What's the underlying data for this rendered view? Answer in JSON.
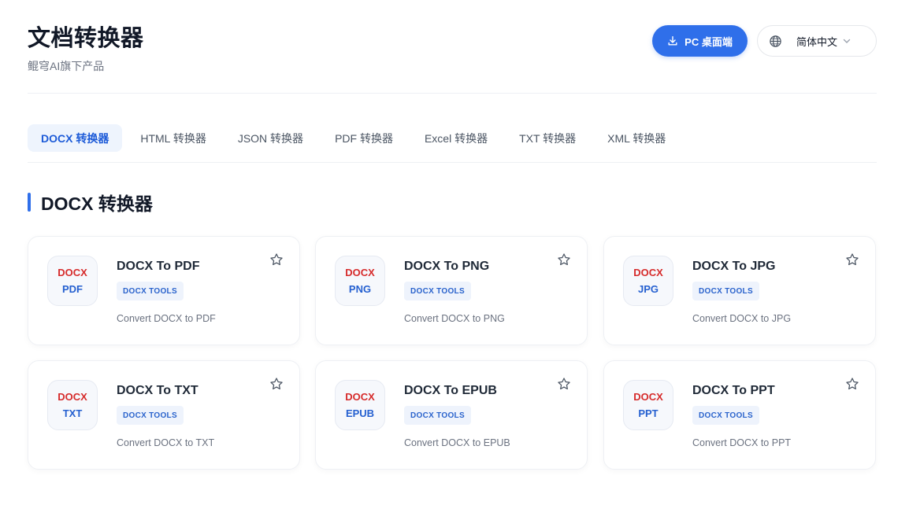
{
  "header": {
    "title": "文档转换器",
    "subtitle": "鲲穹AI旗下产品",
    "pc_button": "PC 桌面端",
    "language": "简体中文"
  },
  "tabs": [
    {
      "label": "DOCX 转换器",
      "active": true
    },
    {
      "label": "HTML 转换器",
      "active": false
    },
    {
      "label": "JSON 转换器",
      "active": false
    },
    {
      "label": "PDF 转换器",
      "active": false
    },
    {
      "label": "Excel 转换器",
      "active": false
    },
    {
      "label": "TXT 转换器",
      "active": false
    },
    {
      "label": "XML 转换器",
      "active": false
    }
  ],
  "section": {
    "title": "DOCX 转换器"
  },
  "cards": [
    {
      "from": "DOCX",
      "to": "PDF",
      "name": "DOCX To PDF",
      "tag": "DOCX TOOLS",
      "desc": "Convert DOCX to PDF"
    },
    {
      "from": "DOCX",
      "to": "PNG",
      "name": "DOCX To PNG",
      "tag": "DOCX TOOLS",
      "desc": "Convert DOCX to PNG"
    },
    {
      "from": "DOCX",
      "to": "JPG",
      "name": "DOCX To JPG",
      "tag": "DOCX TOOLS",
      "desc": "Convert DOCX to JPG"
    },
    {
      "from": "DOCX",
      "to": "TXT",
      "name": "DOCX To TXT",
      "tag": "DOCX TOOLS",
      "desc": "Convert DOCX to TXT"
    },
    {
      "from": "DOCX",
      "to": "EPUB",
      "name": "DOCX To EPUB",
      "tag": "DOCX TOOLS",
      "desc": "Convert DOCX to EPUB"
    },
    {
      "from": "DOCX",
      "to": "PPT",
      "name": "DOCX To PPT",
      "tag": "DOCX TOOLS",
      "desc": "Convert DOCX to PPT"
    }
  ],
  "colors": {
    "accent": "#2f6fea",
    "from_format": "#d62b2b",
    "to_format": "#2560d0"
  },
  "icons": {
    "download": "download-icon",
    "globe": "globe-icon",
    "chevron": "chevron-down-icon",
    "star": "star-icon"
  }
}
